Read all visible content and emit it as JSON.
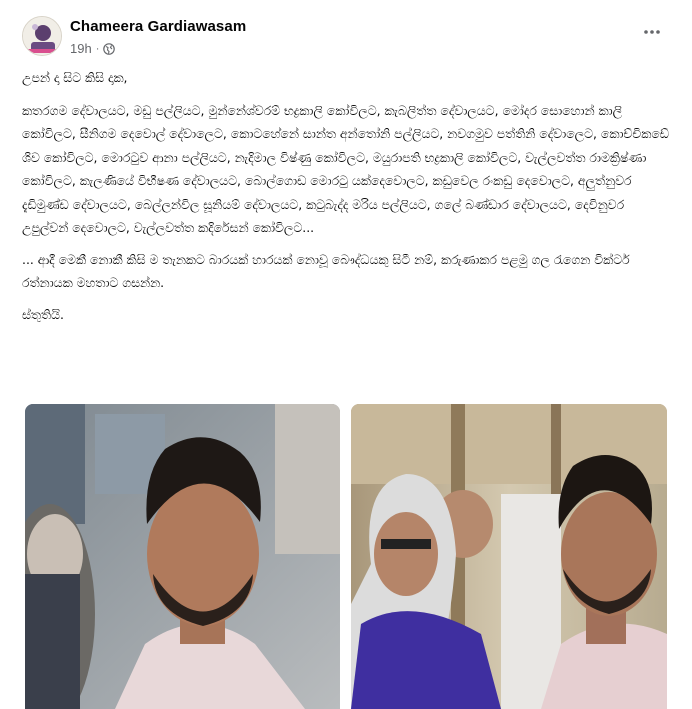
{
  "post": {
    "author": "Chameera Gardiawasam",
    "time": "19h",
    "separator": "·",
    "visibility_icon": "globe-icon",
    "more_icon": "more-options-icon",
    "paragraphs": [
      "උපන් දා සිට කිසි දාක,",
      "කතරගම දේවාලයට, මඩු පල්ලියට, මුන්නේශ්වරම් භද්‍රකාලි කෝවිලට, කැබලිත්ත දේවාලයට, මෝදර සොහොන් කාලි කෝවිලට, සීනිගම දෙවොල් දේවාලෙට, කොටහේනේ සාන්ත අන්තෝනි පල්ලියට, නවගමුව පත්තිනි දේවාලෙට, කොච්චිකඩේ ශිව කෝවිලට, මොරටුව ආනා පල්ලියට, නැදිමාල විෂ්ණු කෝවිලට, මයුරාපති භද්‍රකාලි කෝවිලට, වැල්ලවත්ත රාමක්‍රිෂ්ණා කෝවිලට, කැලණියේ විභීෂණ දේවාලයට, බොල්ගොඩ මොරටු යක්දෙවොලට, කඩුවෙල රංකඩු දෙවොලට, අලුත්නුවර දැඩිමුණ්ඩ දේවාලයට, බෙල්ලන්විල සූනියම් දේවාලයට, කටුබැද්ද මරිය පල්ලියට, ගලේ බණ්ඩාර දේවාලයට, දෙවිනුවර උපුල්වන් දෙවොලට, වැල්ලවත්ත කදිරේසන් කෝවිලට...",
      "... ආදී මෙකී නොකී කිසි ම තැනකට බාරයක් හාරයක් නොවූ බෞද්ධයකු සිටී නම්, කරුණාකර පළමු ගල රැගෙන වික්ටර් රත්නායක මහතාට ගසන්න.",
      "ස්තුතියි."
    ],
    "photos": [
      {
        "name": "photo-young-man-closeup"
      },
      {
        "name": "photo-elderly-man-and-young-man"
      }
    ]
  },
  "colors": {
    "text": "#050505",
    "secondary": "#65676b",
    "background": "#ffffff"
  }
}
